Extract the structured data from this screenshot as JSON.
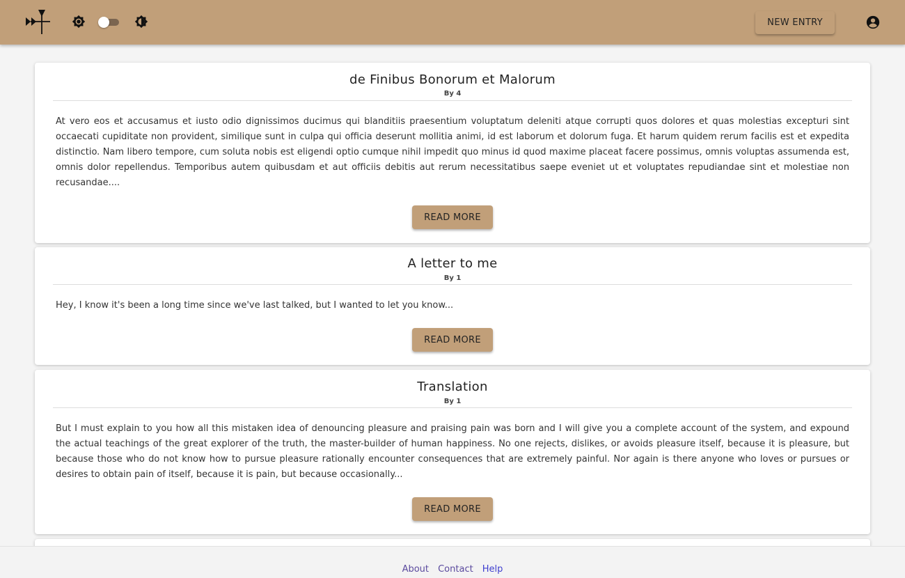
{
  "appbar": {
    "new_entry_label": "NEW ENTRY",
    "background": "#c19f79"
  },
  "entries": [
    {
      "title": "de Finibus Bonorum et Malorum",
      "author": "By 4",
      "excerpt": "At vero eos et accusamus et iusto odio dignissimos ducimus qui blanditiis praesentium voluptatum deleniti atque corrupti quos dolores et quas molestias excepturi sint occaecati cupiditate non provident, similique sunt in culpa qui officia deserunt mollitia animi, id est laborum et dolorum fuga. Et harum quidem rerum facilis est et expedita distinctio. Nam libero tempore, cum soluta nobis est eligendi optio cumque nihil impedit quo minus id quod maxime placeat facere possimus, omnis voluptas assumenda est, omnis dolor repellendus. Temporibus autem quibusdam et aut officiis debitis aut rerum necessitatibus saepe eveniet ut et voluptates repudiandae sint et molestiae non recusandae....",
      "read_more": "READ MORE"
    },
    {
      "title": "A letter to me",
      "author": "By 1",
      "excerpt": "Hey, I know it's been a long time since we've last talked, but I wanted to let you know...",
      "read_more": "READ MORE"
    },
    {
      "title": "Translation",
      "author": "By 1",
      "excerpt": "But I must explain to you how all this mistaken idea of denouncing pleasure and praising pain was born and I will give you a complete account of the system, and expound the actual teachings of the great explorer of the truth, the master-builder of human happiness. No one rejects, dislikes, or avoids pleasure itself, because it is pleasure, but because those who do not know how to pursue pleasure rationally encounter consequences that are extremely painful. Nor again is there anyone who loves or pursues or desires to obtain pain of itself, because it is pain, but because occasionally...",
      "read_more": "READ MORE"
    }
  ],
  "footer": {
    "links": [
      "About",
      "Contact",
      "Help"
    ]
  }
}
